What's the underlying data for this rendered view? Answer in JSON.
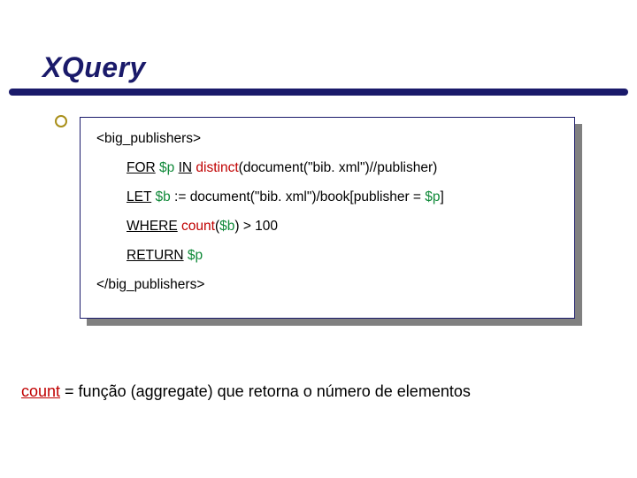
{
  "title": "XQuery",
  "code": {
    "open_tag": "<big_publishers>",
    "for_kw": "FOR",
    "for_var": "$p",
    "in_kw": "IN",
    "distinct_fn": "distinct",
    "for_tail": "(document(\"bib. xml\")//publisher)",
    "let_kw": "LET",
    "let_var": "$b",
    "let_mid": " := document(\"bib. xml\")/book[publisher = ",
    "let_var2": "$p",
    "let_tail": "]",
    "where_kw": "WHERE",
    "count_fn": "count",
    "where_open": "(",
    "where_var": "$b",
    "where_tail": ") > 100",
    "return_kw": "RETURN",
    "return_var": "$p",
    "close_tag": "</big_publishers>"
  },
  "caption": {
    "count_word": "count",
    "rest": "  = função (aggregate) que retorna o número de elementos"
  }
}
